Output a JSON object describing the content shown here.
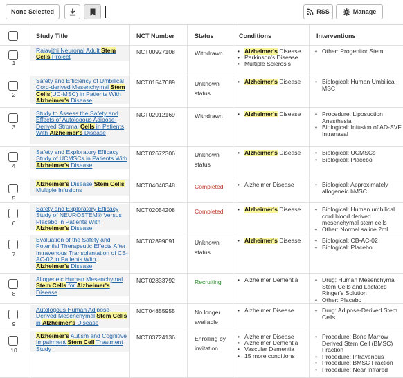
{
  "toolbar": {
    "none_selected_label": "None Selected",
    "rss_label": "RSS",
    "manage_label": "Manage",
    "icons": [
      "download-icon",
      "bookmark-icon",
      "rss-icon",
      "gear-icon"
    ]
  },
  "table": {
    "headers": {
      "study_title": "Study Title",
      "nct_number": "NCT Number",
      "status": "Status",
      "conditions": "Conditions",
      "interventions": "Interventions"
    },
    "rows": [
      {
        "num": "1",
        "title": [
          [
            "Rajavithi Neuronal Adult ",
            false
          ],
          [
            "Stem",
            true
          ],
          [
            " ",
            false
          ],
          [
            "Cells",
            true
          ],
          [
            " Project",
            false
          ]
        ],
        "nct": "NCT00927108",
        "status": "Withdrawn",
        "conditions": [
          [
            [
              "Alzheimer's",
              true
            ],
            [
              " Disease",
              false
            ]
          ],
          [
            [
              "Parkinson's Disease",
              false
            ]
          ],
          [
            [
              "Multiple Sclerosis",
              false
            ]
          ]
        ],
        "interventions": [
          "Other: Progenitor Stem"
        ]
      },
      {
        "num": "2",
        "title": [
          [
            "Safety and Efficiency of Umbilical Cord-derived Mesenchymal ",
            false
          ],
          [
            "Stem Cells",
            true
          ],
          [
            "(UC-MSC) in Patients With ",
            false
          ],
          [
            "Alzheimer's",
            true
          ],
          [
            " Disease",
            false
          ]
        ],
        "nct": "NCT01547689",
        "status": "Unknown status",
        "conditions": [
          [
            [
              "Alzheimer's",
              true
            ],
            [
              " Disease",
              false
            ]
          ]
        ],
        "interventions": [
          "Biological: Human Umbilical MSC"
        ]
      },
      {
        "num": "3",
        "title": [
          [
            "Study to Assess the Safety and Effects of Autologous Adipose-Derived Stromal ",
            false
          ],
          [
            "Cells",
            true
          ],
          [
            " in Patients With ",
            false
          ],
          [
            "Alzheimer's",
            true
          ],
          [
            " Disease",
            false
          ]
        ],
        "nct": "NCT02912169",
        "status": "Withdrawn",
        "conditions": [
          [
            [
              "Alzheimer's",
              true
            ],
            [
              " Disease",
              false
            ]
          ]
        ],
        "interventions": [
          "Procedure: Liposuction Anesthesia",
          "Biological: Infusion of AD-SVF Intranasal"
        ]
      },
      {
        "num": "4",
        "title": [
          [
            "Safety and Exploratory Efficacy Study of UCMSCs in Patients With ",
            false
          ],
          [
            "Alzheimer's",
            true
          ],
          [
            " Disease",
            false
          ]
        ],
        "nct": "NCT02672306",
        "status": "Unknown status",
        "conditions": [
          [
            [
              "Alzheimer's",
              true
            ],
            [
              " Disease",
              false
            ]
          ]
        ],
        "interventions": [
          "Biological: UCMSCs",
          "Biological: Placebo"
        ]
      },
      {
        "num": "5",
        "title": [
          [
            "Alzheimer's",
            true
          ],
          [
            " Disease ",
            false
          ],
          [
            "Stem Cells",
            true
          ],
          [
            " Multiple Infusions",
            false
          ]
        ],
        "nct": "NCT04040348",
        "status": "Completed",
        "conditions": [
          [
            [
              "Alzheimer Disease",
              false
            ]
          ]
        ],
        "interventions": [
          "Biological: Approximately allogeneic hMSC"
        ]
      },
      {
        "num": "6",
        "title": [
          [
            "Safety and Exploratory Efficacy Study of NEUROSTEM® Versus Placebo in Patients With ",
            false
          ],
          [
            "Alzheimer's",
            true
          ],
          [
            " Disease",
            false
          ]
        ],
        "nct": "NCT02054208",
        "status": "Completed",
        "conditions": [
          [
            [
              "Alzheimer's",
              true
            ],
            [
              " Disease",
              false
            ]
          ]
        ],
        "interventions": [
          "Biological: Human umbilical cord blood derived mesenchymal stem cells",
          "Other: Normal saline 2mL"
        ]
      },
      {
        "num": "7",
        "title": [
          [
            "Evaluation of the Safety and Potential Therapeutic Effects After Intravenous Transplantation of CB-AC-02 in Patients With ",
            false
          ],
          [
            "Alzheimer's",
            true
          ],
          [
            " Disease",
            false
          ]
        ],
        "nct": "NCT02899091",
        "status": "Unknown status",
        "conditions": [
          [
            [
              "Alzheimer's",
              true
            ],
            [
              " Disease",
              false
            ]
          ]
        ],
        "interventions": [
          "Biological: CB-AC-02",
          "Biological: Placebo"
        ]
      },
      {
        "num": "8",
        "title": [
          [
            "Allogeneic Human Mesenchymal ",
            false
          ],
          [
            "Stem Cells",
            true
          ],
          [
            " for ",
            false
          ],
          [
            "Alzheimer's",
            true
          ],
          [
            " Disease",
            false
          ]
        ],
        "nct": "NCT02833792",
        "status": "Recruiting",
        "conditions": [
          [
            [
              "Alzheimer Dementia",
              false
            ]
          ]
        ],
        "interventions": [
          "Drug: Human Mesenchymal Stem Cells and Lactated Ringer's Solution",
          "Other: Placebo"
        ]
      },
      {
        "num": "9",
        "title": [
          [
            "Autologous Human Adipose-Derived Mesenchymal ",
            false
          ],
          [
            "Stem Cells",
            true
          ],
          [
            " in ",
            false
          ],
          [
            "Alzheimer's",
            true
          ],
          [
            " Disease",
            false
          ]
        ],
        "nct": "NCT04855955",
        "status": "No longer available",
        "conditions": [
          [
            [
              "Alzheimer Disease",
              false
            ]
          ]
        ],
        "interventions": [
          "Drug: Adipose-Derived Stem Cells"
        ]
      },
      {
        "num": "10",
        "title": [
          [
            "Alzheimer's",
            true
          ],
          [
            " Autism and Cognitive Impairment ",
            false
          ],
          [
            "Stem Cell",
            true
          ],
          [
            " Treatment Study",
            false
          ]
        ],
        "nct": "NCT03724136",
        "status": "Enrolling by invitation",
        "conditions": [
          [
            [
              "Alzheimer Disease",
              false
            ]
          ],
          [
            [
              "Alzheimer Dementia",
              false
            ]
          ],
          [
            [
              "Vascular Dementia",
              false
            ]
          ],
          [
            [
              "15 more conditions",
              false
            ]
          ]
        ],
        "interventions": [
          "Procedure: Bone Marrow Derived Stem Cell (BMSC) Fraction",
          "Procedure: Intravenous",
          "Procedure: BMSC Fraction",
          "Procedure: Near Infrared"
        ]
      }
    ]
  },
  "colors": {
    "link": "#2264a6",
    "highlight": "#fbf59a",
    "completed": "#c0392b",
    "recruiting": "#2e8b2e"
  }
}
